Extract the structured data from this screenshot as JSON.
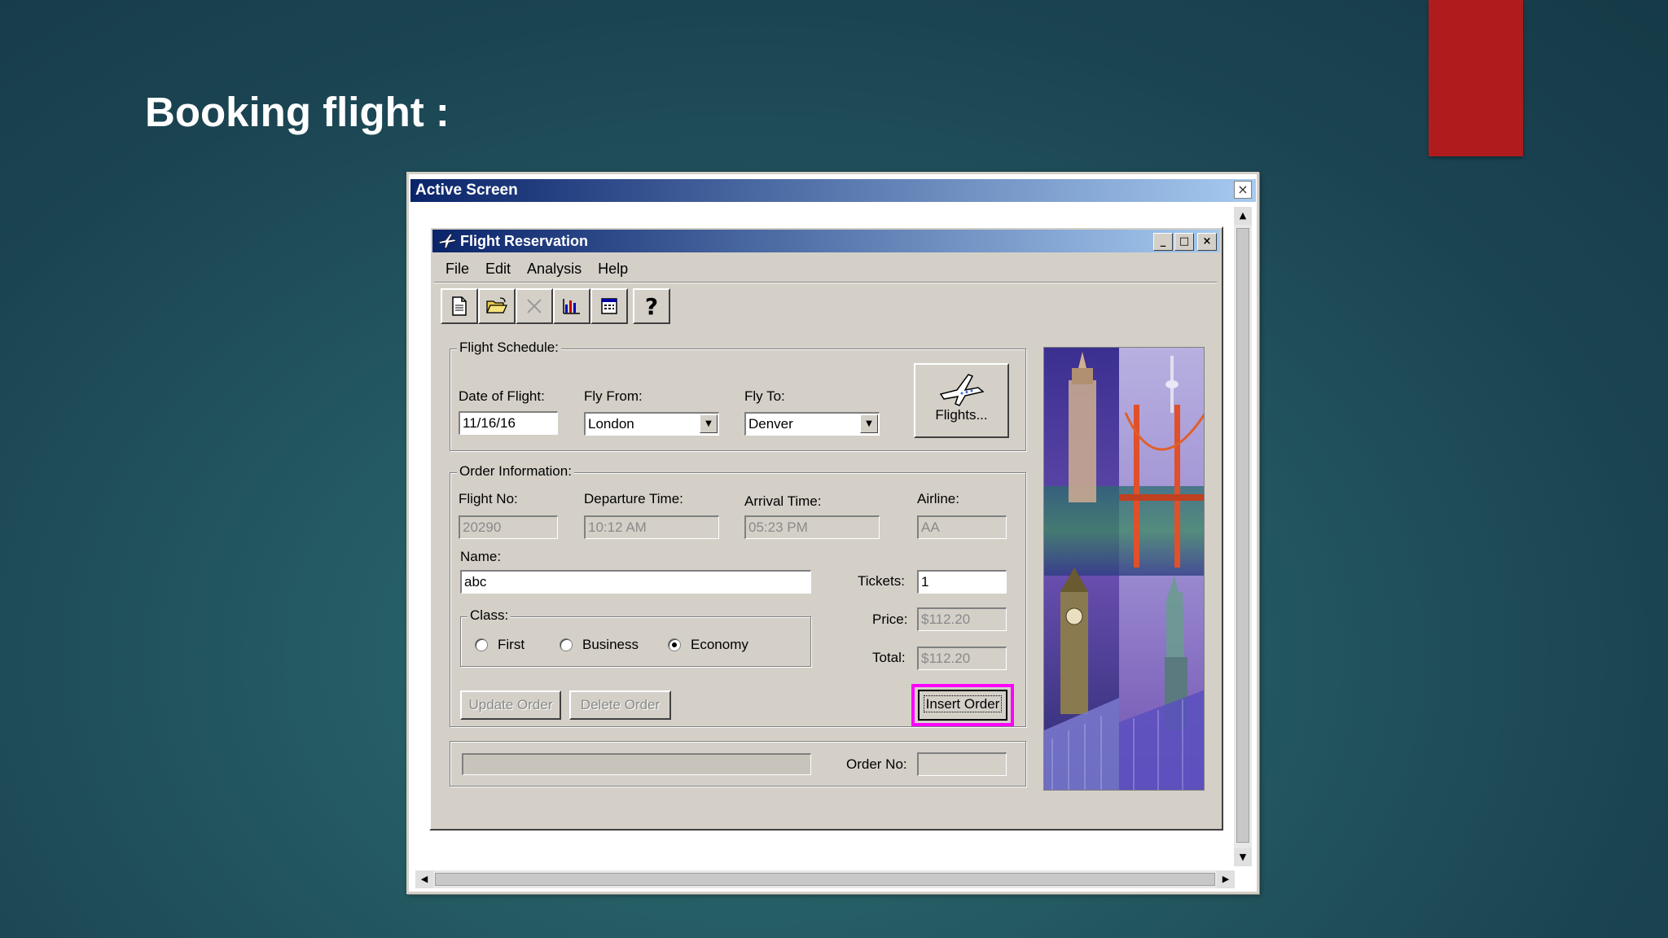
{
  "slide": {
    "title": "Booking flight :"
  },
  "outer_window": {
    "title": "Active Screen",
    "close_glyph": "×"
  },
  "window": {
    "title": "Flight Reservation",
    "minimize_glyph": "_",
    "maximize_glyph": "□",
    "close_glyph": "×"
  },
  "menu": [
    "File",
    "Edit",
    "Analysis",
    "Help"
  ],
  "toolbar": {
    "icons": [
      "new-document-icon",
      "open-folder-icon",
      "delete-icon",
      "chart-icon",
      "calendar-icon",
      "help-icon"
    ],
    "help_glyph": "?"
  },
  "schedule": {
    "group_label": "Flight Schedule:",
    "date_label": "Date of Flight:",
    "date_value": "11/16/16",
    "from_label": "Fly From:",
    "from_value": "London",
    "to_label": "Fly To:",
    "to_value": "Denver",
    "flights_button": "Flights..."
  },
  "order": {
    "group_label": "Order Information:",
    "flight_no_label": "Flight No:",
    "flight_no_value": "20290",
    "departure_label": "Departure Time:",
    "departure_value": "10:12 AM",
    "arrival_label": "Arrival Time:",
    "arrival_value": "05:23 PM",
    "airline_label": "Airline:",
    "airline_value": "AA",
    "name_label": "Name:",
    "name_value": "abc",
    "tickets_label": "Tickets:",
    "tickets_value": "1",
    "price_label": "Price:",
    "price_value": "$112.20",
    "total_label": "Total:",
    "total_value": "$112.20",
    "class_label": "Class:",
    "class_options": [
      "First",
      "Business",
      "Economy"
    ],
    "class_selected": "Economy",
    "update_button": "Update Order",
    "delete_button": "Delete Order",
    "insert_button": "Insert Order"
  },
  "status": {
    "order_no_label": "Order No:",
    "order_no_value": ""
  },
  "colors": {
    "title_bar": "#0a246a",
    "highlight": "#ff00ff",
    "accent_red": "#b01c1e",
    "window_face": "#d4d0c8"
  }
}
